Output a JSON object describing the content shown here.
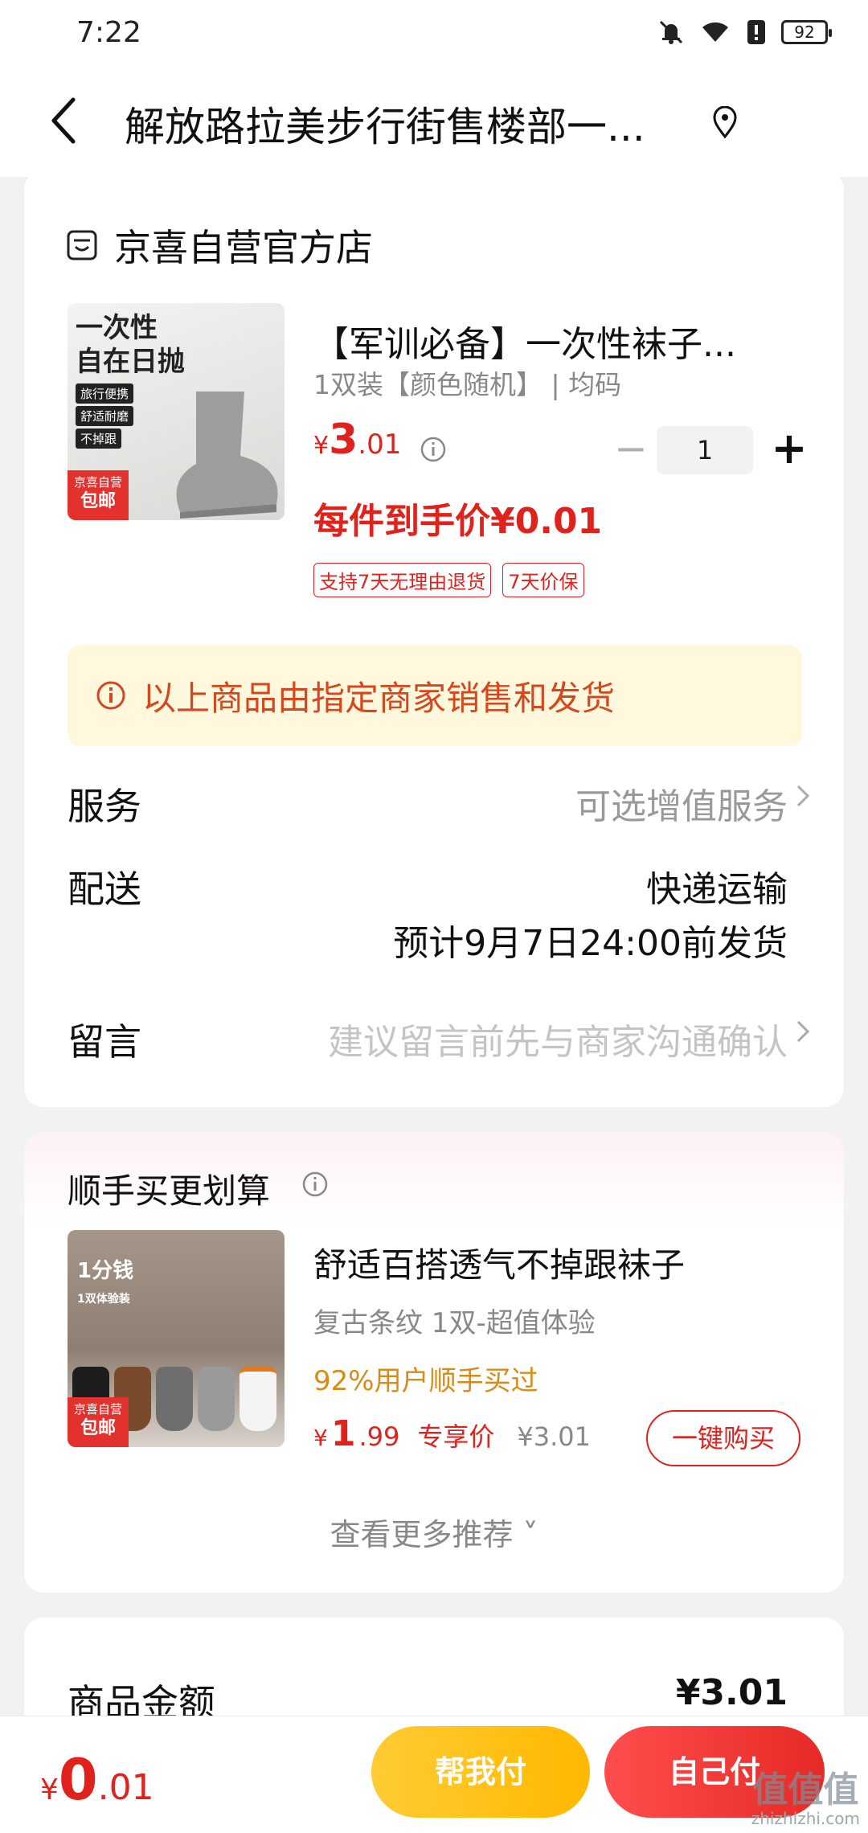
{
  "status_bar": {
    "time": "7:22",
    "battery": "92"
  },
  "header": {
    "title": "解放路拉美步行街售楼部一..."
  },
  "shop": {
    "name": "京喜自营官方店"
  },
  "product": {
    "image_text": "一次性\n自在日抛",
    "image_tags": [
      "旅行便携",
      "舒适耐磨",
      "不掉跟"
    ],
    "image_badge_top": "京喜自营",
    "image_badge_bottom": "包邮",
    "title": "【军训必备】一次性袜子...",
    "spec": "1双装【颜色随机】 | 均码",
    "price_symbol": "¥",
    "price_int": "3",
    "price_dec": ".01",
    "quantity": "1",
    "minus": "−",
    "plus": "+",
    "deal_price": "每件到手价¥0.01",
    "tags": [
      "支持7天无理由退货",
      "7天价保"
    ]
  },
  "notice": {
    "text": "以上商品由指定商家销售和发货"
  },
  "service": {
    "label": "服务",
    "value": "可选增值服务"
  },
  "delivery": {
    "label": "配送",
    "method": "快递运输",
    "eta": "预计9月7日24:00前发货"
  },
  "message": {
    "label": "留言",
    "placeholder": "建议留言前先与商家沟通确认"
  },
  "recommend": {
    "title": "顺手买更划算",
    "image_tag": "1分钱",
    "image_sub": "1双体验装",
    "image_badge_top": "京喜自营",
    "image_badge_bottom": "包邮",
    "name": "舒适百搭透气不掉跟袜子",
    "spec": "复古条纹   1双-超值体验",
    "popularity": "92%用户顺手买过",
    "price_symbol": "¥",
    "price_int": "1",
    "price_dec": ".99",
    "exclusive_label": "专享价",
    "original_price": "¥3.01",
    "buy_label": "一键购买",
    "more_label": "查看更多推荐 ˅"
  },
  "summary": {
    "label": "商品金额",
    "value": "¥3.01"
  },
  "bottom": {
    "total_symbol": "¥",
    "total_int": "0",
    "total_dec": ".01",
    "help_pay": "帮我付",
    "self_pay": "自己付"
  },
  "watermark": {
    "big": "值值值",
    "small": "zhizhizhi.com"
  },
  "colors": {
    "price_red": "#e0221c",
    "notice_bg": "#fff8dc",
    "notice_text": "#d4471f",
    "help_pay": "#ffbe1a",
    "self_pay": "#e62a26"
  }
}
